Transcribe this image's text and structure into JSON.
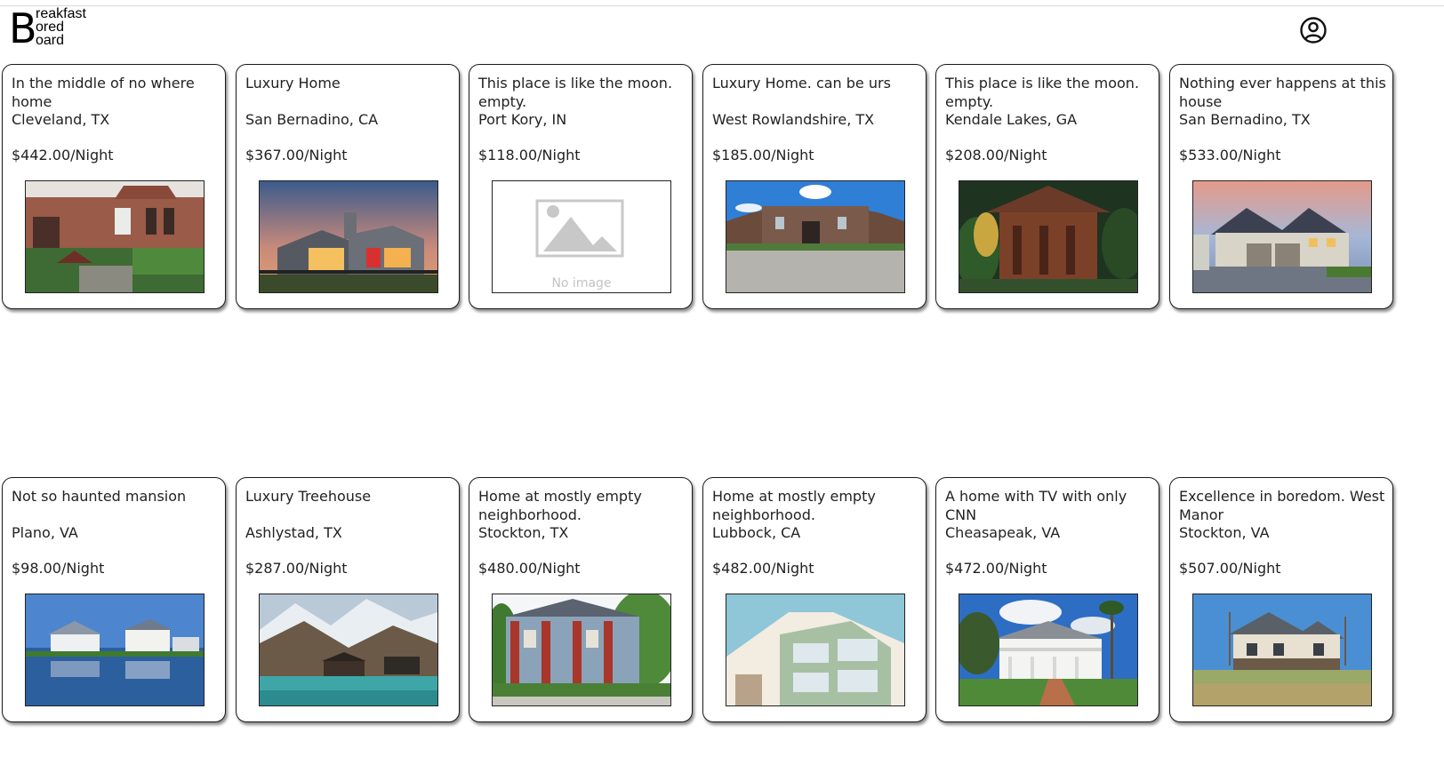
{
  "brand": {
    "big_letter": "B",
    "line1": "reakfast",
    "line2": "ored",
    "line3": "oard"
  },
  "account_icon": "user-circle-icon",
  "listings": [
    {
      "title": "In the middle of no where home",
      "location": "Cleveland, TX",
      "price": "$442.00/Night",
      "image": "brick-house"
    },
    {
      "title": "Luxury Home",
      "location": "San Bernadino, CA",
      "price": "$367.00/Night",
      "image": "modern-home-dusk"
    },
    {
      "title": "This place is like the moon. empty.",
      "location": "Port Kory, IN",
      "price": "$118.00/Night",
      "image": "placeholder",
      "no_image_text": "No image"
    },
    {
      "title": "Luxury Home. can be urs",
      "location": "West Rowlandshire, TX",
      "price": "$185.00/Night",
      "image": "mansion-blue-sky"
    },
    {
      "title": "This place is like the moon. empty.",
      "location": "Kendale Lakes, GA",
      "price": "$208.00/Night",
      "image": "wooden-cabin"
    },
    {
      "title": "Nothing ever happens at this house",
      "location": "San Bernadino, TX",
      "price": "$533.00/Night",
      "image": "suburban-house-sunset"
    },
    {
      "title": "Not so haunted mansion",
      "location": "Plano, VA",
      "price": "$98.00/Night",
      "image": "lake-houses"
    },
    {
      "title": "Luxury Treehouse",
      "location": "Ashlystad, TX",
      "price": "$287.00/Night",
      "image": "mountain-lake"
    },
    {
      "title": "Home at mostly empty neighborhood.",
      "location": "Stockton, TX",
      "price": "$480.00/Night",
      "image": "victorian-house"
    },
    {
      "title": "Home at mostly empty neighborhood.",
      "location": "Lubbock, CA",
      "price": "$482.00/Night",
      "image": "apartment-building"
    },
    {
      "title": "A home with TV with only CNN",
      "location": "Cheasapeak, VA",
      "price": "$472.00/Night",
      "image": "white-mansion-palms"
    },
    {
      "title": "Excellence in boredom. West Manor",
      "location": "Stockton, VA",
      "price": "$507.00/Night",
      "image": "farmhouse-field"
    }
  ]
}
